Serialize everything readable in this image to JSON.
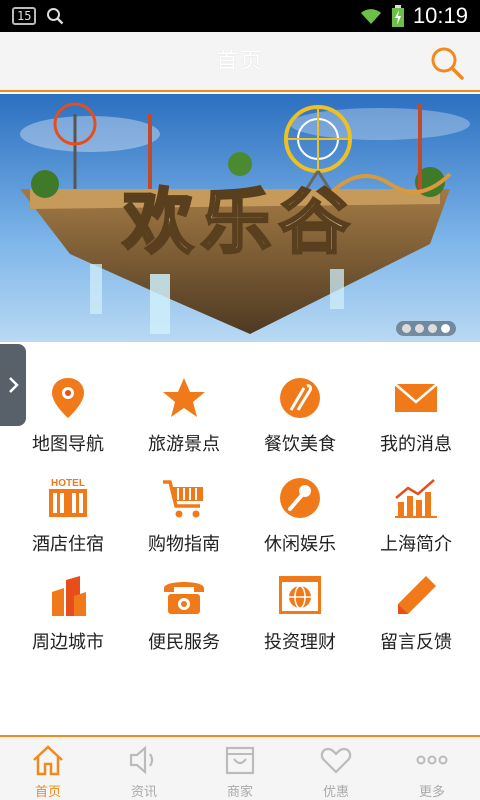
{
  "status_bar": {
    "badge": "15",
    "time": "10:19"
  },
  "header": {
    "title": "首页"
  },
  "banner": {
    "headline": "欢乐谷",
    "slide_count": 4,
    "active_slide": 4
  },
  "grid": {
    "items": [
      {
        "label": "地图导航",
        "icon": "map-pin-icon"
      },
      {
        "label": "旅游景点",
        "icon": "star-icon"
      },
      {
        "label": "餐饮美食",
        "icon": "dining-icon"
      },
      {
        "label": "我的消息",
        "icon": "envelope-icon"
      },
      {
        "label": "酒店住宿",
        "icon": "hotel-icon",
        "icon_text": "HOTEL"
      },
      {
        "label": "购物指南",
        "icon": "shopping-cart-icon"
      },
      {
        "label": "休闲娱乐",
        "icon": "microphone-icon"
      },
      {
        "label": "上海简介",
        "icon": "chart-icon"
      },
      {
        "label": "周边城市",
        "icon": "buildings-icon"
      },
      {
        "label": "便民服务",
        "icon": "telephone-icon"
      },
      {
        "label": "投资理财",
        "icon": "globe-window-icon"
      },
      {
        "label": "留言反馈",
        "icon": "pencil-icon"
      }
    ]
  },
  "bottom_nav": {
    "items": [
      {
        "label": "首页",
        "icon": "home-icon",
        "active": true
      },
      {
        "label": "资讯",
        "icon": "speaker-icon",
        "active": false
      },
      {
        "label": "商家",
        "icon": "shop-bag-icon",
        "active": false
      },
      {
        "label": "优惠",
        "icon": "heart-icon",
        "active": false
      },
      {
        "label": "更多",
        "icon": "more-dots-icon",
        "active": false
      }
    ]
  },
  "colors": {
    "accent": "#f08a1c",
    "icon_orange": "#f07a1a",
    "icon_red": "#e84e1b"
  }
}
